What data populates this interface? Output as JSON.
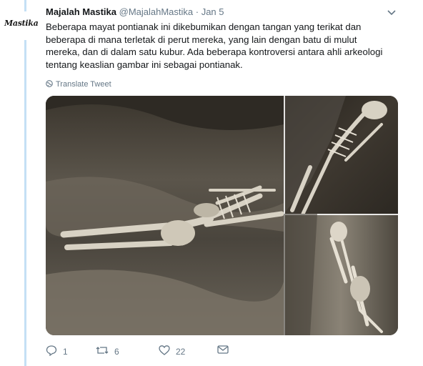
{
  "tweet": {
    "author_name": "Majalah Mastika",
    "author_handle": "@MajalahMastika",
    "separator": " · ",
    "date": "Jan 5",
    "avatar_text": "Mastika",
    "text": "Beberapa mayat pontianak ini dikebumikan dengan tangan yang terikat dan beberapa di mana terletak di perut mereka, yang lain dengan batu di mulut mereka, dan di dalam satu kubur. Ada beberapa kontroversi antara ahli arkeologi tentang keaslian gambar ini sebagai pontianak.",
    "translate_label": "Translate Tweet",
    "media_description": "skeletons",
    "actions": {
      "reply_count": "1",
      "retweet_count": "6",
      "like_count": "22"
    }
  },
  "icons": {
    "reply": "reply-icon",
    "retweet": "retweet-icon",
    "like": "heart-icon",
    "dm": "mail-icon",
    "globe": "globe-icon",
    "caret": "chevron-down-icon"
  },
  "colors": {
    "thread_line": "#c4e0f5",
    "muted": "#657786",
    "text": "#14171a"
  }
}
